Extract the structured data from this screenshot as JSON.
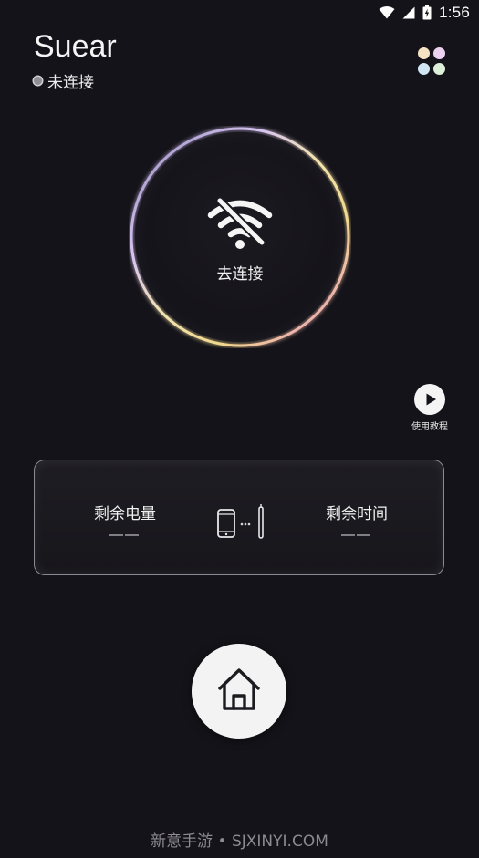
{
  "status_bar": {
    "time": "1:56",
    "icons": [
      "wifi-icon",
      "cellular-signal-icon",
      "battery-charging-icon"
    ]
  },
  "header": {
    "app_title": "Suear",
    "connection_status": "未连接",
    "menu_icon": "apps-grid-icon"
  },
  "connect": {
    "icon": "wifi-off-icon",
    "label": "去连接",
    "ring_colors": [
      "#b9a7f3",
      "#f0c6f0",
      "#e98fc8",
      "#f4e3a0",
      "#ffffff"
    ]
  },
  "tutorial": {
    "icon": "play-icon",
    "label": "使用教程"
  },
  "info_card": {
    "battery_label": "剩余电量",
    "battery_value": "——",
    "time_label": "剩余时间",
    "time_value": "——",
    "link_icon": "phone-to-otoscope-icon"
  },
  "home": {
    "icon": "home-icon"
  },
  "watermark": "新意手游 • SJXINYI.COM",
  "colors": {
    "background": "#141319",
    "home_button": "#f3f3f3",
    "card_border": "#8b8a92"
  }
}
